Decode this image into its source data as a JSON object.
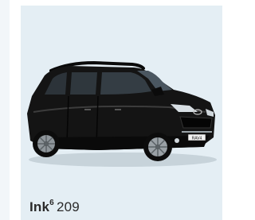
{
  "card": {
    "brand": "Ink",
    "superscript": "6",
    "model_number": "209",
    "image_subject": "black-suv",
    "plate_text": "RAV4"
  },
  "colors": {
    "card_background": "#e4eef4",
    "car_body": "#121212",
    "caption_text": "#2a2a2a"
  }
}
